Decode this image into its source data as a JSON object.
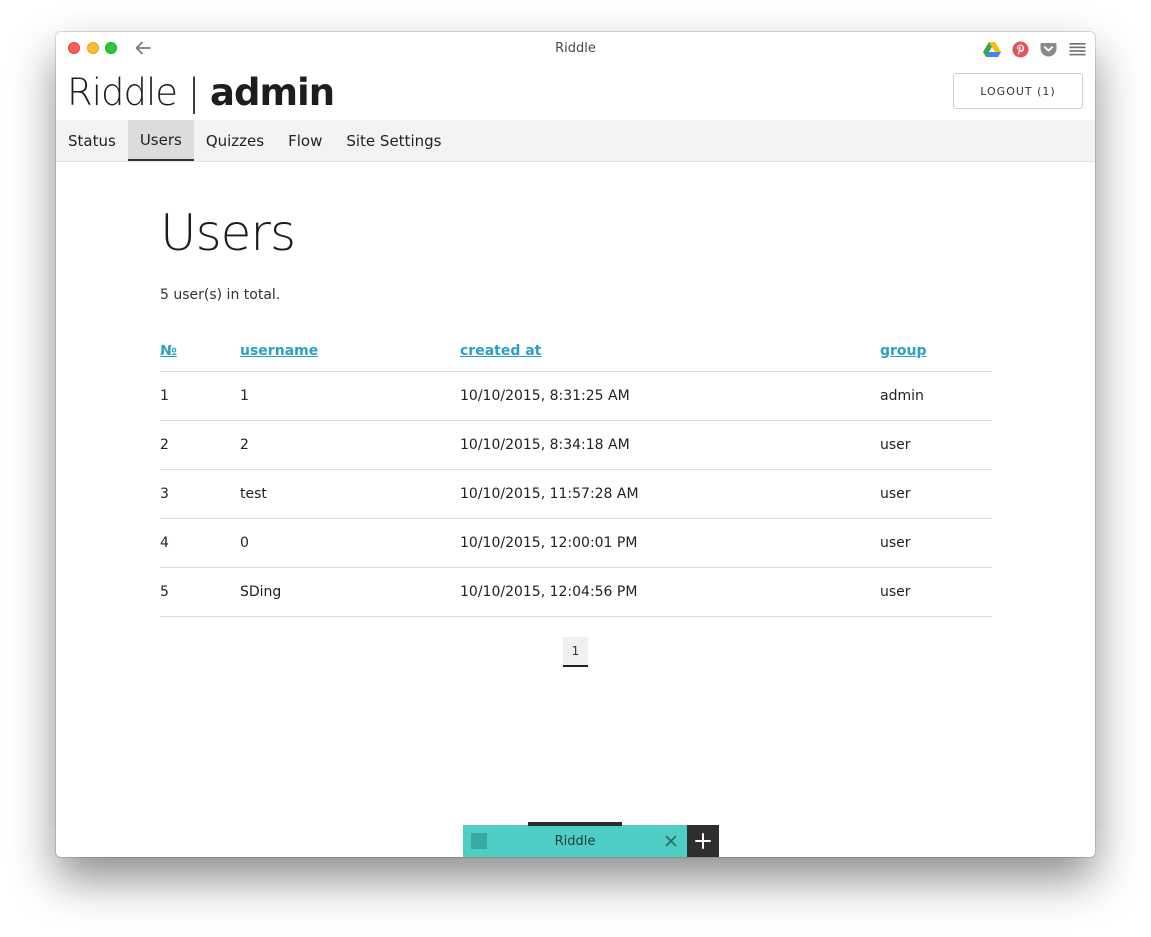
{
  "window": {
    "title": "Riddle"
  },
  "header": {
    "brand_light": "Riddle |",
    "brand_bold": "admin",
    "logout_label": "LOGOUT (1)"
  },
  "nav": {
    "items": [
      {
        "label": "Status",
        "active": false
      },
      {
        "label": "Users",
        "active": true
      },
      {
        "label": "Quizzes",
        "active": false
      },
      {
        "label": "Flow",
        "active": false
      },
      {
        "label": "Site Settings",
        "active": false
      }
    ]
  },
  "main": {
    "title": "Users",
    "total_text": "5 user(s) in total.",
    "table": {
      "headers": [
        "№",
        "username",
        "created at",
        "group"
      ],
      "rows": [
        [
          "1",
          "1",
          "10/10/2015, 8:31:25 AM",
          "admin"
        ],
        [
          "2",
          "2",
          "10/10/2015, 8:34:18 AM",
          "user"
        ],
        [
          "3",
          "test",
          "10/10/2015, 11:57:28 AM",
          "user"
        ],
        [
          "4",
          "0",
          "10/10/2015, 12:00:01 PM",
          "user"
        ],
        [
          "5",
          "SDing",
          "10/10/2015, 12:04:56 PM",
          "user"
        ]
      ]
    },
    "pagination": {
      "current_page": "1"
    }
  },
  "tabbar": {
    "tab_label": "Riddle"
  },
  "icons": {
    "back": "back-arrow-icon",
    "drive": "google-drive-icon",
    "pinterest": "pinterest-icon",
    "pocket": "pocket-icon",
    "menu": "hamburger-menu-icon",
    "close": "close-icon",
    "add": "plus-icon"
  },
  "colors": {
    "link": "#2aa0c8",
    "tab": "#4ecdc4",
    "nav_bg": "#f3f3f3",
    "nav_active": "#dcdcdc"
  }
}
